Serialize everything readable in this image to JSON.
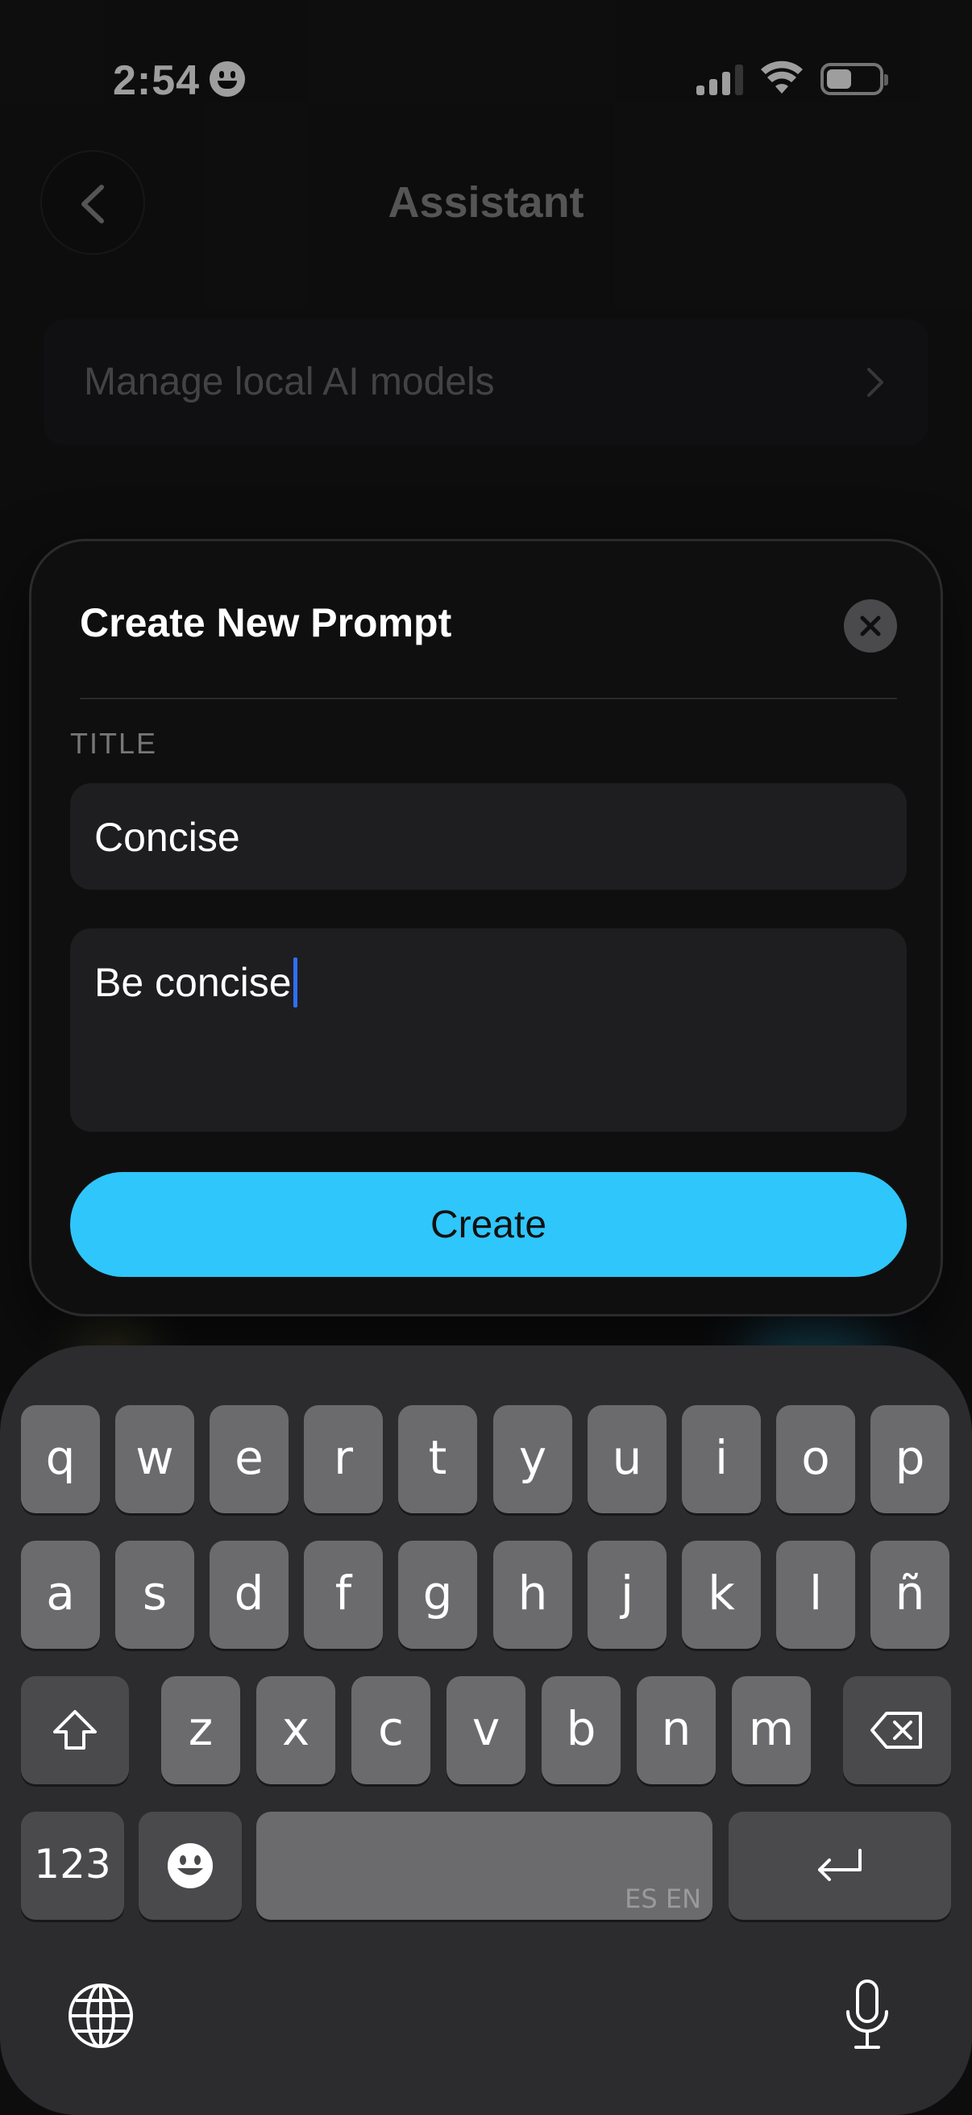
{
  "status_bar": {
    "time": "2:54"
  },
  "header": {
    "title": "Assistant"
  },
  "settings": {
    "manage_models_label": "Manage local AI models"
  },
  "modal": {
    "title": "Create New Prompt",
    "title_field_label": "TITLE",
    "title_value": "Concise",
    "prompt_value": "Be concise",
    "create_label": "Create"
  },
  "keyboard": {
    "row1": [
      "q",
      "w",
      "e",
      "r",
      "t",
      "y",
      "u",
      "i",
      "o",
      "p"
    ],
    "row2": [
      "a",
      "s",
      "d",
      "f",
      "g",
      "h",
      "j",
      "k",
      "l",
      "ñ"
    ],
    "row3": [
      "z",
      "x",
      "c",
      "v",
      "b",
      "n",
      "m"
    ],
    "numbers_label": "123",
    "space_language_hint": "ES EN"
  },
  "colors": {
    "accent": "#2fc6fb",
    "caret": "#2f6fff",
    "background": "#161618",
    "key": "#6b6b6e"
  }
}
